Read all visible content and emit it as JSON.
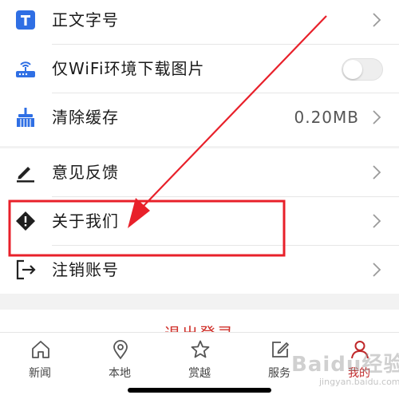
{
  "settings": {
    "font_size": {
      "label": "正文字号",
      "icon": "text-size-icon"
    },
    "wifi_images": {
      "label": "仅WiFi环境下载图片",
      "icon": "router-icon",
      "enabled": false
    },
    "clear_cache": {
      "label": "清除缓存",
      "value": "0.20MB",
      "icon": "broom-icon"
    },
    "feedback": {
      "label": "意见反馈",
      "icon": "pencil-icon"
    },
    "about": {
      "label": "关于我们",
      "icon": "info-diamond-icon"
    },
    "sign_out_account": {
      "label": "注销账号",
      "icon": "exit-icon"
    }
  },
  "logout": {
    "label": "退出登录"
  },
  "tabbar": {
    "tabs": [
      {
        "label": "新闻",
        "icon": "home-icon",
        "active": false
      },
      {
        "label": "本地",
        "icon": "location-pin-icon",
        "active": false
      },
      {
        "label": "赏越",
        "icon": "star-icon",
        "active": false
      },
      {
        "label": "服务",
        "icon": "edit-square-icon",
        "active": false
      },
      {
        "label": "我的",
        "icon": "user-icon",
        "active": true
      }
    ]
  },
  "colors": {
    "accent_red": "#d0302a",
    "icon_blue": "#2f6fe4",
    "highlight_box": "#e8202a"
  },
  "watermark": {
    "text": "Baidu经验",
    "sub": "jingyan.baidu.com"
  }
}
